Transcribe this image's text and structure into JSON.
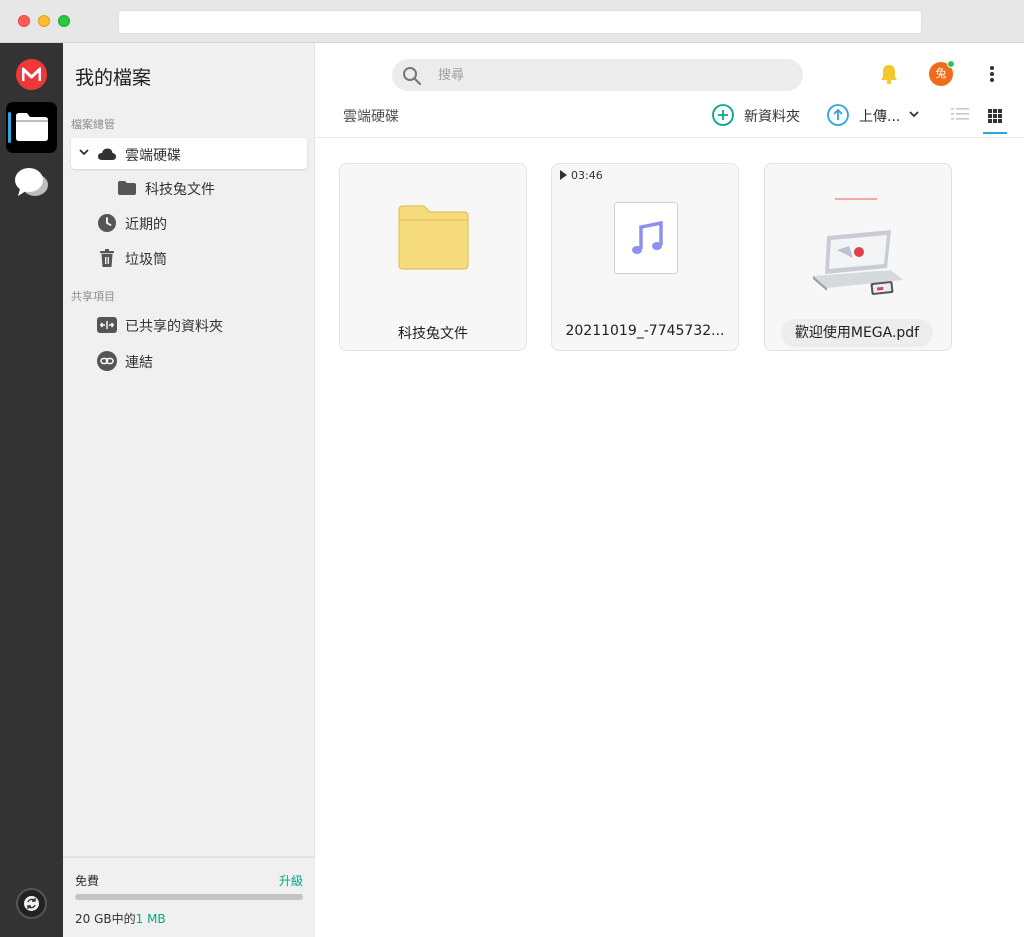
{
  "sidebar": {
    "title": "我的檔案",
    "section_cloud": "檔案總管",
    "section_shared": "共享項目",
    "items": [
      {
        "label": "雲端硬碟"
      },
      {
        "label": "科技兔文件"
      },
      {
        "label": "近期的"
      },
      {
        "label": "垃圾筒"
      },
      {
        "label": "已共享的資料夾"
      },
      {
        "label": "連結"
      }
    ],
    "footer": {
      "plan": "免費",
      "upgrade": "升級",
      "usage_prefix": "20 GB中的",
      "usage_value": "1 MB",
      "usage_fraction": 0.0
    }
  },
  "header": {
    "search_placeholder": "搜尋",
    "avatar_initial": "兔"
  },
  "toolbar": {
    "breadcrumb": "雲端硬碟",
    "new_folder": "新資料夾",
    "upload": "上傳..."
  },
  "files": [
    {
      "name": "科技兔文件",
      "type": "folder"
    },
    {
      "name": "20211019_-7745732...",
      "type": "audio",
      "duration": "03:46"
    },
    {
      "name": "歡迎使用MEGA.pdf",
      "type": "pdf"
    }
  ],
  "colors": {
    "accent": "#00a886",
    "brand": "#f0373a",
    "highlight": "#2ba6de"
  }
}
